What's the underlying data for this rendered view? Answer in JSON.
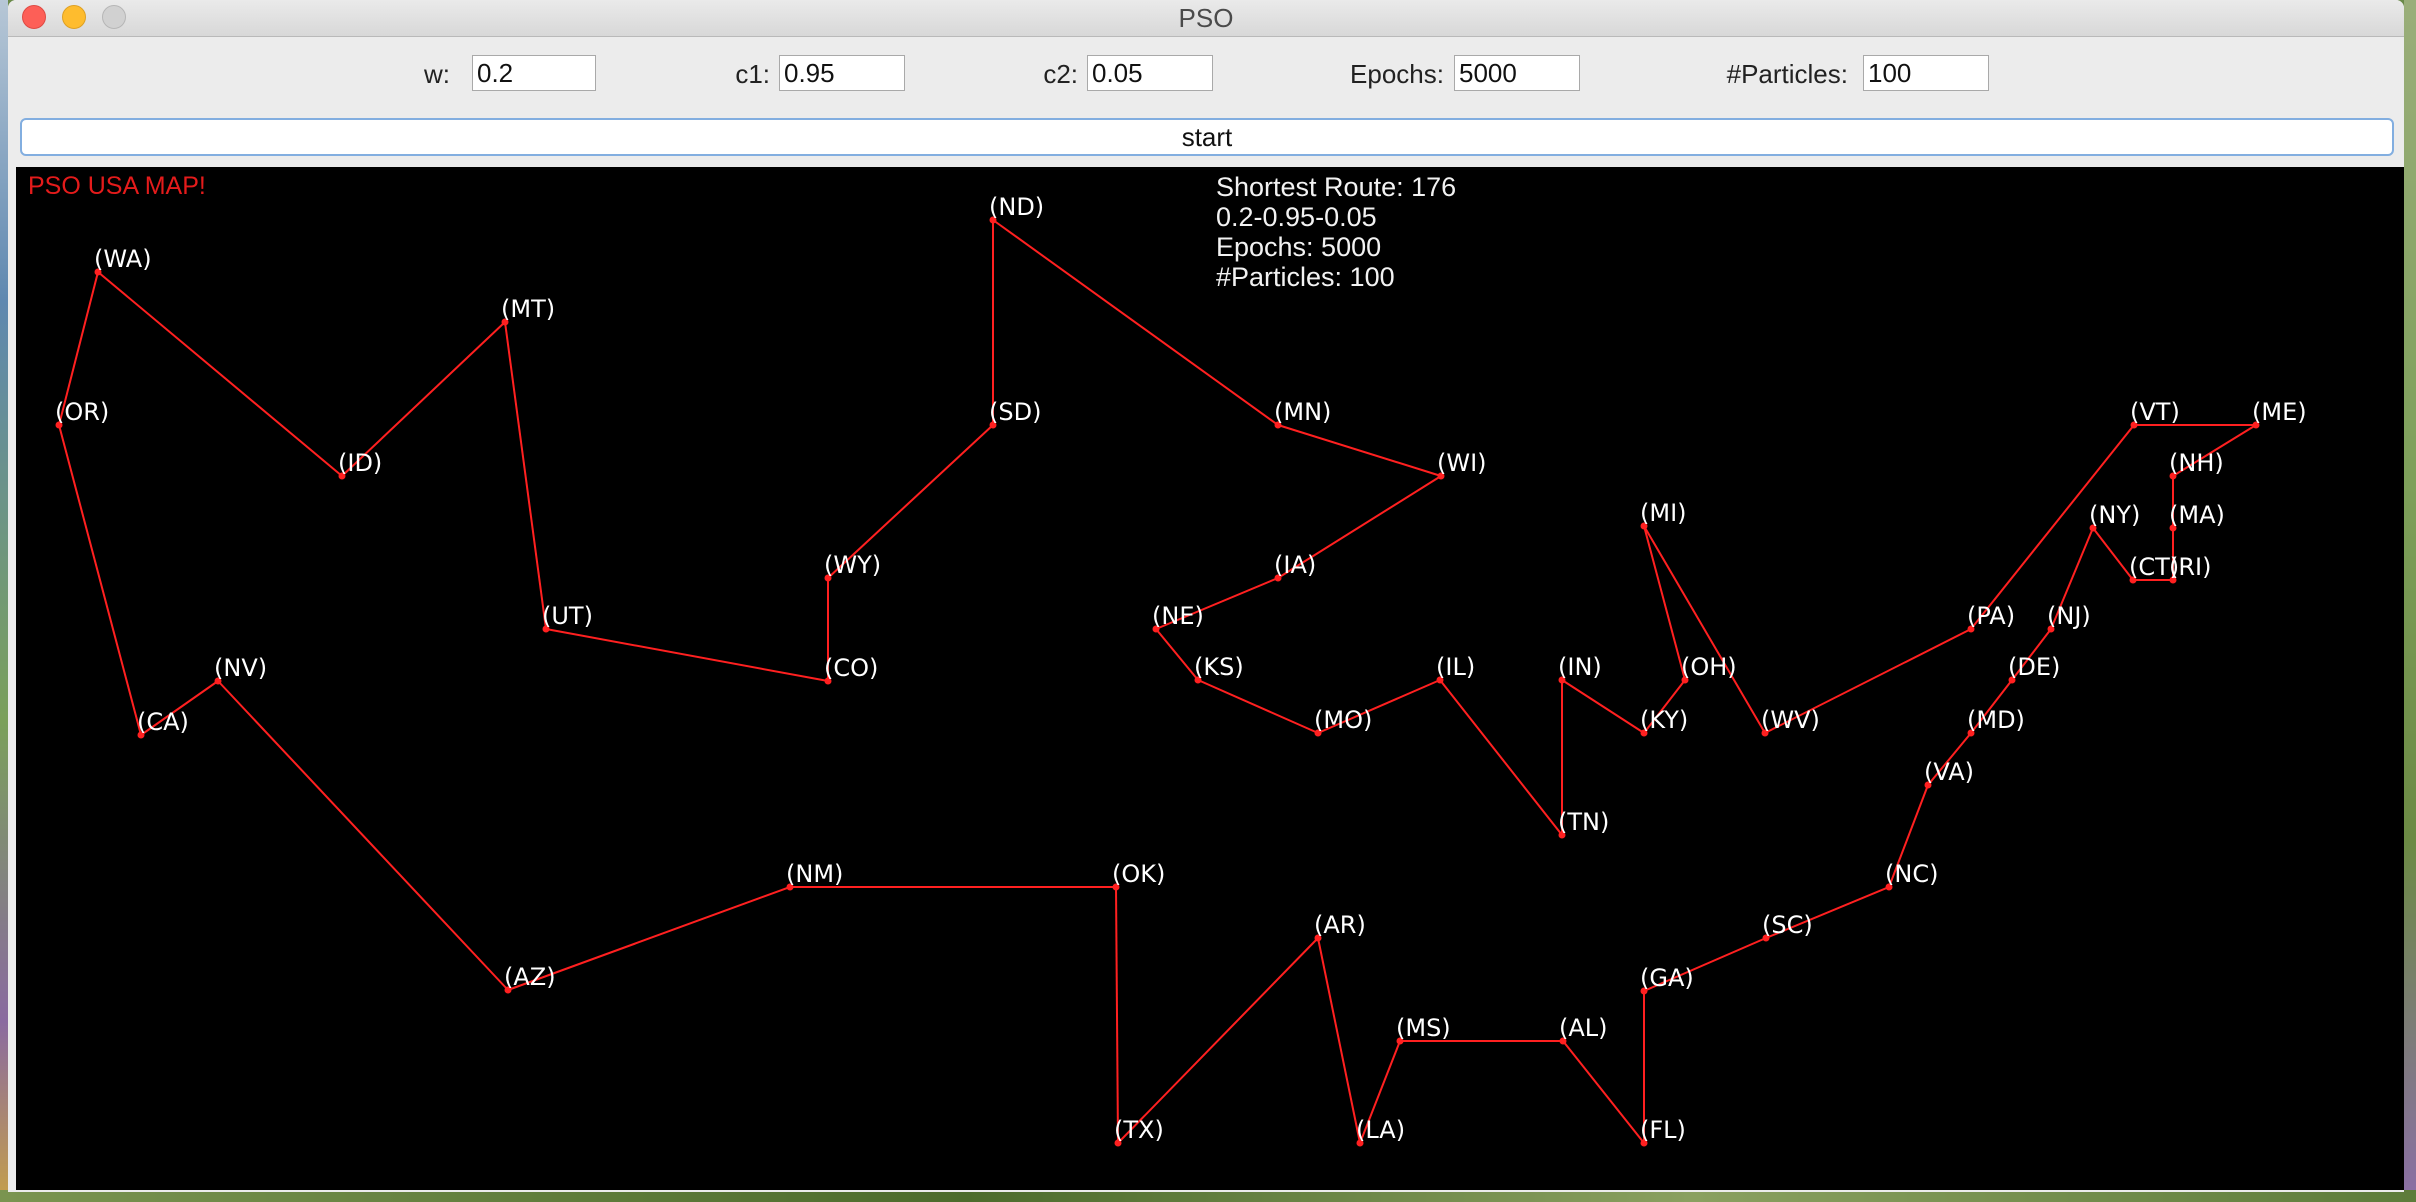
{
  "window": {
    "title": "PSO"
  },
  "params": {
    "w": {
      "label": "w:",
      "value": "0.2"
    },
    "c1": {
      "label": "c1:",
      "value": "0.95"
    },
    "c2": {
      "label": "c2:",
      "value": "0.05"
    },
    "epochs": {
      "label": "Epochs:",
      "value": "5000"
    },
    "particles": {
      "label": "#Particles:",
      "value": "100"
    }
  },
  "start_button": {
    "label": "start"
  },
  "map": {
    "title": "PSO USA MAP!",
    "stats": {
      "shortest_route": "Shortest Route: 176",
      "params_line": "0.2-0.95-0.05",
      "epochs_line": "Epochs: 5000",
      "particles_line": "#Particles: 100"
    },
    "route_color": "#ff2020",
    "label_color": "#ffffff",
    "cities": [
      "(WA)",
      "(OR)",
      "(CA)",
      "(NV)",
      "(AZ)",
      "(NM)",
      "(OK)",
      "(TX)",
      "(AR)",
      "(LA)",
      "(MS)",
      "(AL)",
      "(FL)",
      "(GA)",
      "(SC)",
      "(NC)",
      "(VA)",
      "(MD)",
      "(DE)",
      "(NJ)",
      "(NY)",
      "(CT)",
      "(RI)",
      "(MA)",
      "(NH)",
      "(ME)",
      "(VT)",
      "(PA)",
      "(WV)",
      "(MI)",
      "(OH)",
      "(KY)",
      "(IN)",
      "(TN)",
      "(IL)",
      "(MO)",
      "(KS)",
      "(NE)",
      "(IA)",
      "(WI)",
      "(MN)",
      "(ND)",
      "(SD)",
      "(WY)",
      "(CO)",
      "(UT)",
      "(MT)",
      "(ID)"
    ]
  }
}
